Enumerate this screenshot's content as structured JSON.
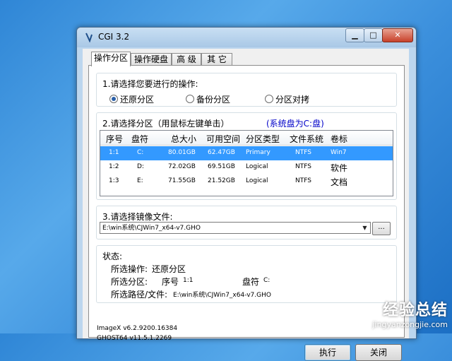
{
  "window": {
    "title": "CGI 3.2",
    "min_icon": "minimize-icon",
    "max_icon": "maximize-icon",
    "close_icon": "close-icon"
  },
  "tabs": [
    {
      "label": "操作分区",
      "active": true
    },
    {
      "label": "操作硬盘"
    },
    {
      "label": "高 级"
    },
    {
      "label": "其 它"
    }
  ],
  "op_section": {
    "label": "1.请选择您要进行的操作:",
    "options": [
      {
        "label": "还原分区",
        "selected": true
      },
      {
        "label": "备份分区",
        "selected": false
      },
      {
        "label": "分区对拷",
        "selected": false
      }
    ]
  },
  "partition_section": {
    "label": "2.请选择分区（用鼠标左键单击）",
    "system_disk": "(系统盘为C:盘)",
    "columns": [
      "序号",
      "盘符",
      "总大小",
      "可用空间",
      "分区类型",
      "文件系统",
      "卷标"
    ],
    "rows": [
      {
        "index": "1:1",
        "drive": "C:",
        "total": "80.01GB",
        "free": "62.47GB",
        "type": "Primary",
        "fs": "NTFS",
        "label": "Win7",
        "selected": true
      },
      {
        "index": "1:2",
        "drive": "D:",
        "total": "72.02GB",
        "free": "69.51GB",
        "type": "Logical",
        "fs": "NTFS",
        "label": "软件"
      },
      {
        "index": "1:3",
        "drive": "E:",
        "total": "71.55GB",
        "free": "21.52GB",
        "type": "Logical",
        "fs": "NTFS",
        "label": "文档"
      }
    ]
  },
  "image_section": {
    "label": "3.请选择镜像文件:",
    "path": "E:\\win系统\\CJWin7_x64-v7.GHO",
    "browse_label": "..."
  },
  "status_section": {
    "label": "状态:",
    "op_label": "所选操作:",
    "op_value": "还原分区",
    "part_label": "所选分区:",
    "part_index_label": "序号",
    "part_index": "1:1",
    "part_drive_label": "盘符",
    "part_drive": "C:",
    "path_label": "所选路径/文件:",
    "path_value": "E:\\win系统\\CJWin7_x64-v7.GHO"
  },
  "version_info": {
    "imagex": "ImageX v6.2.9200.16384",
    "ghost": "GHOST64 v11.5.1.2269"
  },
  "buttons": {
    "execute": "执行",
    "close": "关闭"
  },
  "watermark": {
    "logo": "经验总结",
    "url": "jingyanzongjie.com"
  }
}
